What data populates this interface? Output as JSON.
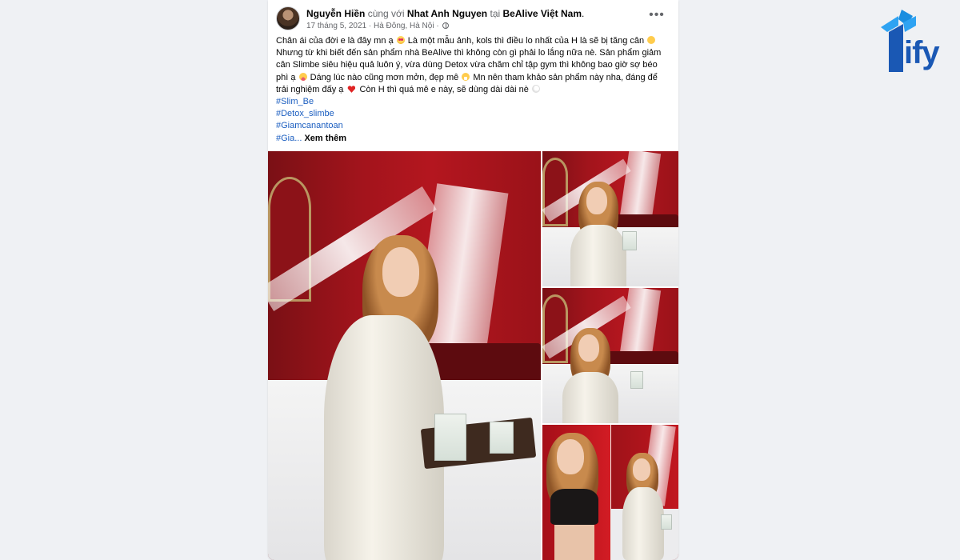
{
  "post": {
    "author": "Nguyễn Hiền",
    "with_word": "cùng với",
    "tagged_user": "Nhat Anh Nguyen",
    "at_word": "tại",
    "location": "BeAlive Việt Nam",
    "location_suffix": ".",
    "date": "17 tháng 5, 2021",
    "place": "Hà Đông, Hà Nội",
    "meta_separator": " · ",
    "privacy_icon": "globe-icon",
    "more_icon": "more-horizontal-icon",
    "more_label": "•••",
    "text_part1": "Chân ái của đời e là đây mn ạ",
    "text_part2": " Là một mẫu ảnh, kols thì điều lo nhất của H là sẽ bị tăng cân",
    "text_part3": " Nhưng từ khi biết đến sản phẩm nhà BeAlive thì không còn gì phải lo lắng nữa nè. Sản phẩm giảm cân Slimbe siêu hiệu quả luôn ý, vừa dùng Detox vừa chăm chỉ tập gym thì không bao giờ sợ béo phì ạ",
    "text_part4": " Dáng lúc nào cũng mơn mởn, đẹp mê",
    "text_part5": " Mn nên tham khảo sản phẩm này nha, đáng để trải nghiệm đấy ạ",
    "text_part6": " Còn H thì quá mê e này, sẽ dùng dài dài nè",
    "hashtags": [
      "#Slim_Be",
      "#Detox_slimbe",
      "#Giamcanantoan"
    ],
    "truncated_hashtag": "#Gia...",
    "see_more": "Xem thêm"
  },
  "logo": {
    "text": "ify",
    "color": "#1a58b4"
  },
  "colors": {
    "link": "#1b5ec0",
    "muted": "#65676b",
    "wall_red": "#b4161f"
  }
}
